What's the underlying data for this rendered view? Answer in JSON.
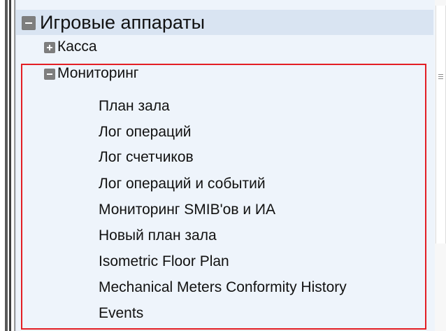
{
  "tree": {
    "root": {
      "label": "Игровые аппараты",
      "icon": "minus-box-icon",
      "expanded": true
    },
    "kassa": {
      "label": "Касса",
      "icon": "plus-box-icon",
      "expanded": false
    },
    "monitoring": {
      "label": "Мониторинг",
      "icon": "minus-box-icon",
      "expanded": true,
      "children": [
        "План зала",
        "Лог операций",
        "Лог счетчиков",
        "Лог операций и событий",
        "Мониторинг SMIB'ов и ИА",
        "Новый план зала",
        "Isometric Floor Plan",
        "Mechanical Meters Conformity History",
        "Events"
      ]
    }
  },
  "colors": {
    "panel_background": "#eef4fb",
    "root_highlight": "#d9e4f2",
    "selection_border": "#e31e24"
  }
}
